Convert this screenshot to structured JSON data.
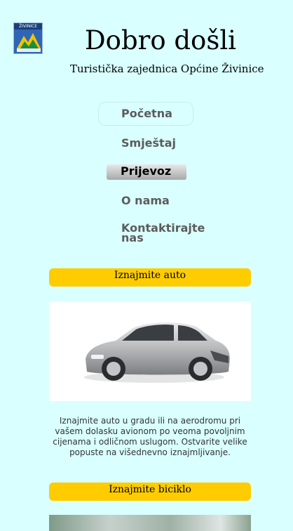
{
  "header": {
    "logo_text": "ŽIVINICE",
    "title": "Dobro došli",
    "subtitle": "Turistička zajednica Općine Živinice"
  },
  "nav": {
    "items": [
      {
        "label": "Početna"
      },
      {
        "label": "Smještaj"
      },
      {
        "label": "Prijevoz"
      },
      {
        "label": "O nama"
      },
      {
        "label": "Kontaktirajte nas"
      }
    ],
    "active": "Prijevoz"
  },
  "sections": [
    {
      "title": "Iznajmite auto",
      "image": "silver-car",
      "description": "Iznajmite auto u gradu ili na aerodromu pri vašem dolasku avionom po veoma povoljnim cijenama i odličnom uslugom. Ostvarite velike popuste na višednevno iznajmljivanje."
    },
    {
      "title": "Iznajmite biciklo",
      "image": "bicycle-street"
    }
  ],
  "colors": {
    "background": "#d9ffff",
    "banner": "#ffcc00",
    "nav_text": "#5c5c5c"
  }
}
